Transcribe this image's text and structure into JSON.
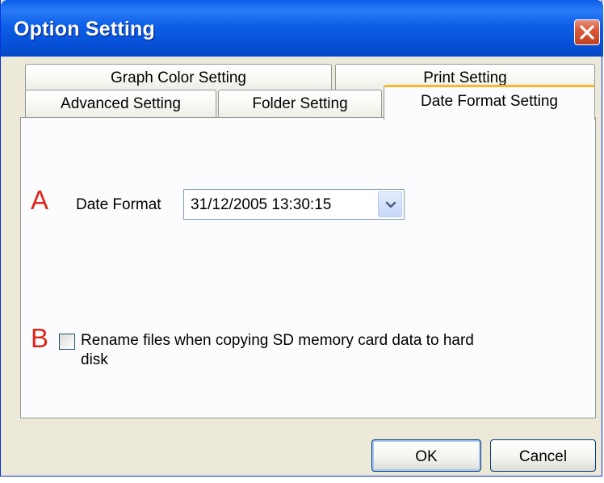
{
  "window": {
    "title": "Option Setting",
    "close_icon": "close-x-icon"
  },
  "tabs": {
    "row1": [
      {
        "label": "Graph Color Setting"
      },
      {
        "label": "Print Setting"
      }
    ],
    "row2": [
      {
        "label": "Advanced Setting"
      },
      {
        "label": "Folder Setting"
      },
      {
        "label": "Date Format Setting",
        "active": true
      }
    ]
  },
  "panel": {
    "marker_a": "A",
    "marker_b": "B",
    "date_format_label": "Date Format",
    "date_format_value": "31/12/2005 13:30:15",
    "dropdown_icon": "chevron-down-icon",
    "rename_checkbox_checked": false,
    "rename_label_line1": "Rename files when copying SD memory card data to hard",
    "rename_label_line2": "disk"
  },
  "buttons": {
    "ok": "OK",
    "cancel": "Cancel"
  },
  "colors": {
    "titlebar": "#0a5ce6",
    "marker": "#e0261b",
    "active_tab_highlight": "#f7b830",
    "dialog_background": "#ece9d8"
  }
}
